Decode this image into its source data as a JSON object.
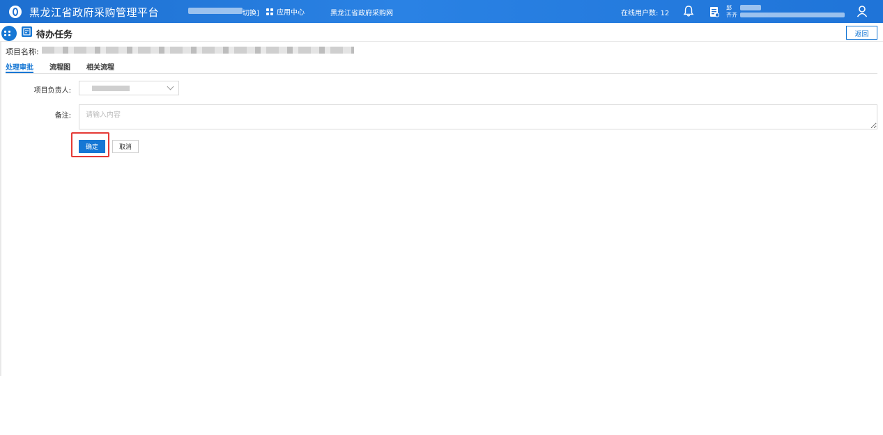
{
  "header": {
    "app_title": "黑龙江省政府采购管理平台",
    "switch_label": "切换]",
    "app_center_label": "应用中心",
    "site_link": "黑龙江省政府采购网",
    "online_users_label": "在线用户数: 12",
    "user_line1": "邱",
    "user_line2": "齐齐"
  },
  "subheader": {
    "title": "待办任务",
    "back_label": "返回"
  },
  "project": {
    "name_label": "项目名称:"
  },
  "tabs": [
    {
      "label": "处理审批",
      "active": true
    },
    {
      "label": "流程图",
      "active": false
    },
    {
      "label": "相关流程",
      "active": false
    }
  ],
  "form": {
    "owner_label": "项目负责人:",
    "remark_label": "备注:",
    "remark_placeholder": "请输入内容",
    "ok_label": "确定",
    "cancel_label": "取消"
  },
  "colors": {
    "primary": "#1677d4",
    "highlight": "#e53935"
  }
}
